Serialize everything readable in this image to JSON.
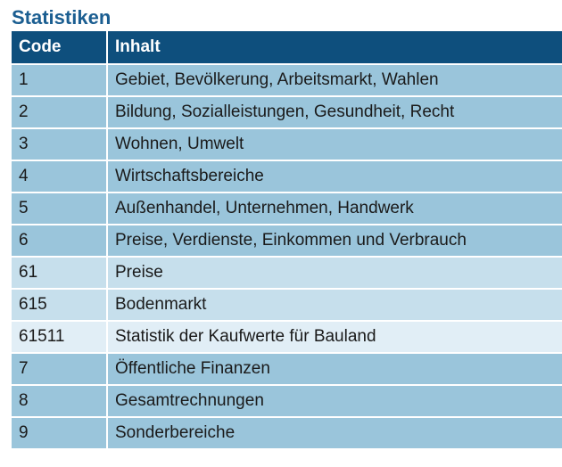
{
  "title": "Statistiken",
  "table": {
    "headers": {
      "code": "Code",
      "content": "Inhalt"
    },
    "rows": [
      {
        "code": "1",
        "content": "Gebiet, Bevölkerung, Arbeitsmarkt, Wahlen",
        "level": 1
      },
      {
        "code": "2",
        "content": "Bildung, Sozialleistungen, Gesundheit, Recht",
        "level": 1
      },
      {
        "code": "3",
        "content": "Wohnen, Umwelt",
        "level": 1
      },
      {
        "code": "4",
        "content": "Wirtschaftsbereiche",
        "level": 1
      },
      {
        "code": "5",
        "content": "Außenhandel, Unternehmen, Handwerk",
        "level": 1
      },
      {
        "code": "6",
        "content": "Preise, Verdienste, Einkommen und Verbrauch",
        "level": 1
      },
      {
        "code": "61",
        "content": "Preise",
        "level": 2
      },
      {
        "code": "615",
        "content": "Bodenmarkt",
        "level": 2
      },
      {
        "code": "61511",
        "content": "Statistik der Kaufwerte für Bauland",
        "level": 3
      },
      {
        "code": "7",
        "content": "Öffentliche Finanzen",
        "level": 1
      },
      {
        "code": "8",
        "content": "Gesamtrechnungen",
        "level": 1
      },
      {
        "code": "9",
        "content": "Sonderbereiche",
        "level": 1
      }
    ]
  },
  "colors": {
    "title": "#1b5e91",
    "header_bg": "#0e4f7d",
    "level_1_bg": "#9ac5db",
    "level_2_bg": "#c6dfec",
    "level_3_bg": "#e1eef6"
  }
}
